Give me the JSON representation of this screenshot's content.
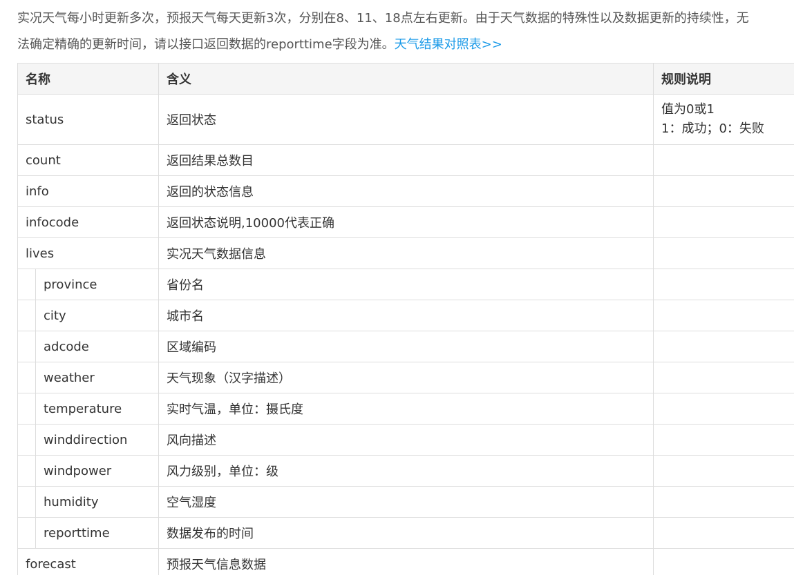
{
  "intro": {
    "line1": "实况天气每小时更新多次，预报天气每天更新3次，分别在8、11、18点左右更新。由于天气数据的特殊性以及数据更新的持续性，无",
    "line2": "法确定精确的更新时间，请以接口返回数据的reporttime字段为准。",
    "link": "天气结果对照表>>",
    "link_color": "#1a9ae8"
  },
  "table": {
    "headers": [
      "名称",
      "含义",
      "规则说明"
    ],
    "rows": [
      {
        "name": "status",
        "meaning": "返回状态",
        "rule1": "值为0或1",
        "rule2": "1：成功；0：失败"
      },
      {
        "name": "count",
        "meaning": "返回结果总数目",
        "rule1": "",
        "rule2": ""
      },
      {
        "name": "info",
        "meaning": "返回的状态信息",
        "rule1": "",
        "rule2": ""
      },
      {
        "name": "infocode",
        "meaning": "返回状态说明,10000代表正确",
        "rule1": "",
        "rule2": ""
      },
      {
        "name": "lives",
        "meaning": "实况天气数据信息",
        "rule1": "",
        "rule2": ""
      },
      {
        "name": "province",
        "meaning": "省份名",
        "rule1": "",
        "rule2": ""
      },
      {
        "name": "city",
        "meaning": "城市名",
        "rule1": "",
        "rule2": ""
      },
      {
        "name": "adcode",
        "meaning": "区域编码",
        "rule1": "",
        "rule2": ""
      },
      {
        "name": "weather",
        "meaning": "天气现象（汉字描述）",
        "rule1": "",
        "rule2": ""
      },
      {
        "name": "temperature",
        "meaning": "实时气温，单位：摄氏度",
        "rule1": "",
        "rule2": ""
      },
      {
        "name": "winddirection",
        "meaning": "风向描述",
        "rule1": "",
        "rule2": ""
      },
      {
        "name": "windpower",
        "meaning": "风力级别，单位：级",
        "rule1": "",
        "rule2": ""
      },
      {
        "name": "humidity",
        "meaning": "空气湿度",
        "rule1": "",
        "rule2": ""
      },
      {
        "name": "reporttime",
        "meaning": "数据发布的时间",
        "rule1": "",
        "rule2": ""
      },
      {
        "name": "forecast",
        "meaning": "预报天气信息数据",
        "rule1": "",
        "rule2": ""
      }
    ]
  }
}
